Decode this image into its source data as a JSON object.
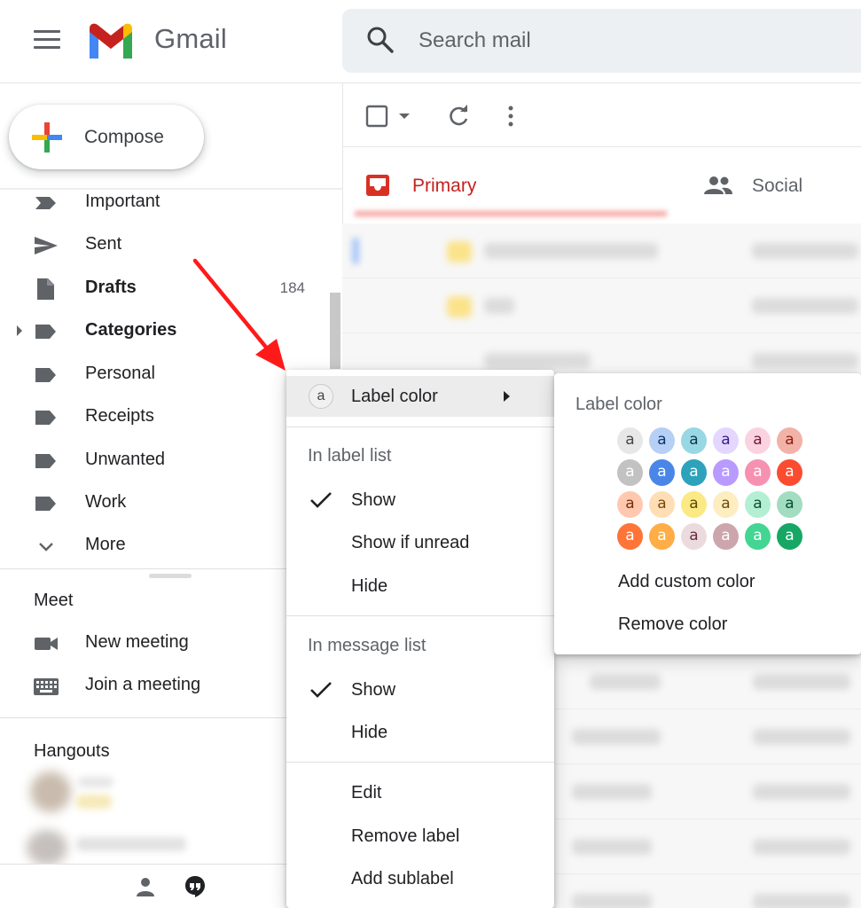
{
  "header": {
    "app_title": "Gmail",
    "search_placeholder": "Search mail"
  },
  "compose": {
    "label": "Compose"
  },
  "sidebar": {
    "items": [
      {
        "label": "Important",
        "bold": false,
        "count": ""
      },
      {
        "label": "Sent",
        "bold": false,
        "count": ""
      },
      {
        "label": "Drafts",
        "bold": true,
        "count": "184"
      },
      {
        "label": "Categories",
        "bold": true,
        "count": ""
      },
      {
        "label": "Personal",
        "bold": false,
        "count": ""
      },
      {
        "label": "Receipts",
        "bold": false,
        "count": ""
      },
      {
        "label": "Unwanted",
        "bold": false,
        "count": ""
      },
      {
        "label": "Work",
        "bold": false,
        "count": ""
      },
      {
        "label": "More",
        "bold": false,
        "count": ""
      }
    ],
    "meet": {
      "title": "Meet",
      "new_meeting": "New meeting",
      "join_meeting": "Join a meeting"
    },
    "hangouts": {
      "title": "Hangouts"
    }
  },
  "tabs": {
    "primary": "Primary",
    "social": "Social"
  },
  "context_menu": {
    "label_color": "Label color",
    "swatch_letter": "a",
    "in_label_list": {
      "header": "In label list",
      "show": "Show",
      "show_if_unread": "Show if unread",
      "hide": "Hide"
    },
    "in_message_list": {
      "header": "In message list",
      "show": "Show",
      "hide": "Hide"
    },
    "edit": "Edit",
    "remove_label": "Remove label",
    "add_sublabel": "Add sublabel"
  },
  "color_menu": {
    "title": "Label color",
    "add_custom_color": "Add custom color",
    "remove_color": "Remove color",
    "swatch_letter": "a",
    "swatches": [
      [
        {
          "bg": "#e7e7e7",
          "fg": "#464646"
        },
        {
          "bg": "#b6cff5",
          "fg": "#0d3472"
        },
        {
          "bg": "#98d7e4",
          "fg": "#0d3b44"
        },
        {
          "bg": "#e3d7ff",
          "fg": "#3d188e"
        },
        {
          "bg": "#fbd3e0",
          "fg": "#711a36"
        },
        {
          "bg": "#f2b2a8",
          "fg": "#8a1c0a"
        }
      ],
      [
        {
          "bg": "#c2c2c2",
          "fg": "#ffffff"
        },
        {
          "bg": "#4986e7",
          "fg": "#ffffff"
        },
        {
          "bg": "#2da2bb",
          "fg": "#ffffff"
        },
        {
          "bg": "#b99aff",
          "fg": "#ffffff"
        },
        {
          "bg": "#f691b2",
          "fg": "#ffffff"
        },
        {
          "bg": "#fb4c2f",
          "fg": "#ffffff"
        }
      ],
      [
        {
          "bg": "#ffc8af",
          "fg": "#7a2e0b"
        },
        {
          "bg": "#ffdeb5",
          "fg": "#7a4706"
        },
        {
          "bg": "#fbe983",
          "fg": "#594c05"
        },
        {
          "bg": "#fdedc1",
          "fg": "#684e07"
        },
        {
          "bg": "#b3efd3",
          "fg": "#0b4f30"
        },
        {
          "bg": "#a2dcc1",
          "fg": "#04502e"
        }
      ],
      [
        {
          "bg": "#ff7537",
          "fg": "#ffffff"
        },
        {
          "bg": "#ffad46",
          "fg": "#ffffff"
        },
        {
          "bg": "#ebdbde",
          "fg": "#662e37"
        },
        {
          "bg": "#cca6ac",
          "fg": "#ffffff"
        },
        {
          "bg": "#42d692",
          "fg": "#ffffff"
        },
        {
          "bg": "#16a765",
          "fg": "#ffffff"
        }
      ]
    ]
  },
  "colors": {
    "primary_tab": "#c5221f",
    "annotation_arrow": "#ff1a1a"
  }
}
